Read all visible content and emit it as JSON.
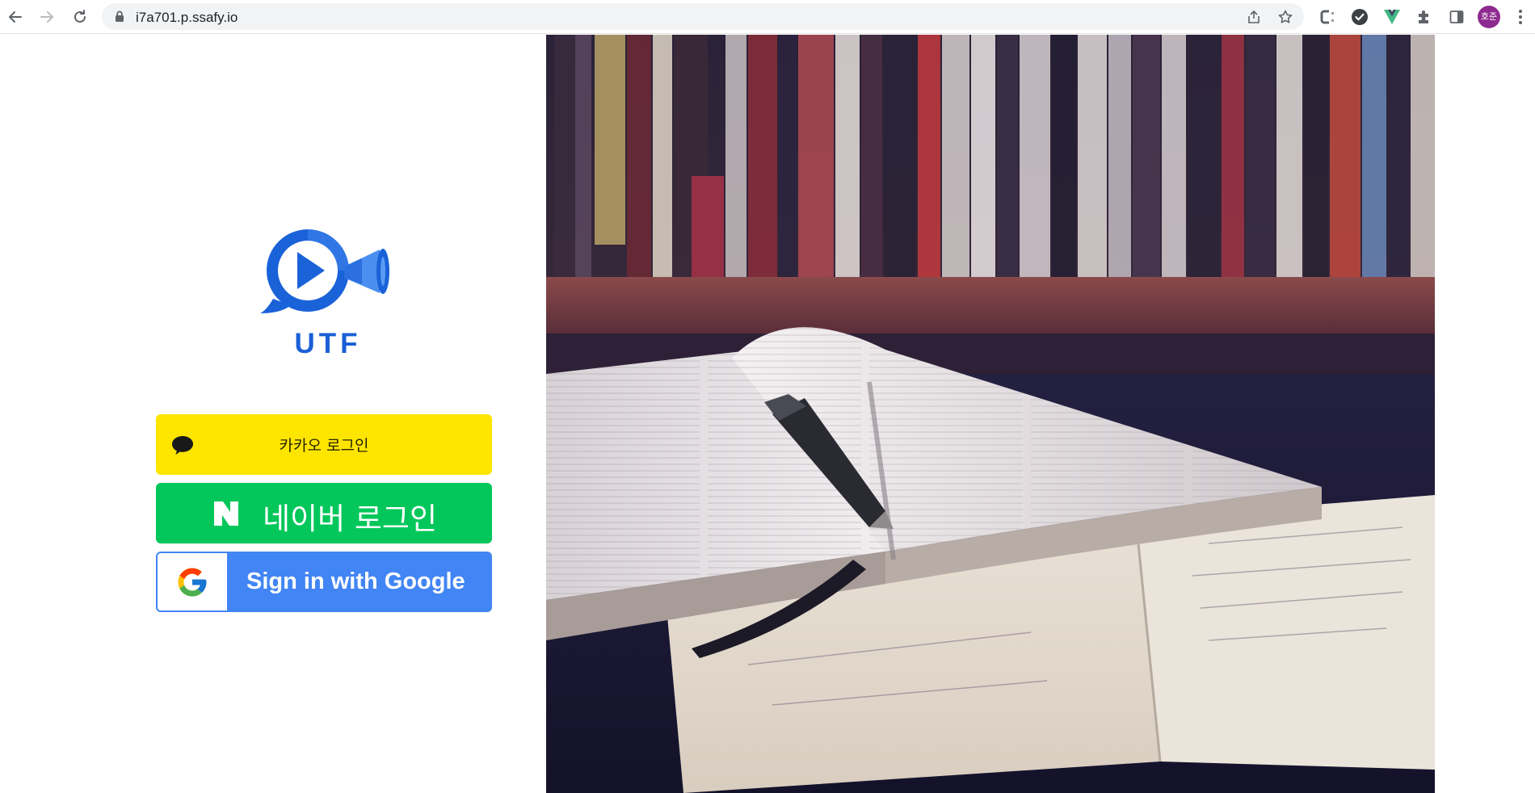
{
  "browser": {
    "url": "i7a701.p.ssafy.io",
    "profile_initials": "호준"
  },
  "logo": {
    "text": "UTF"
  },
  "login": {
    "kakao_label": "카카오 로그인",
    "naver_label": "네이버 로그인",
    "google_label": "Sign in with Google"
  },
  "colors": {
    "kakao": "#FEE500",
    "naver": "#03C75A",
    "google": "#4285F4",
    "logo": "#1A5FD6"
  }
}
